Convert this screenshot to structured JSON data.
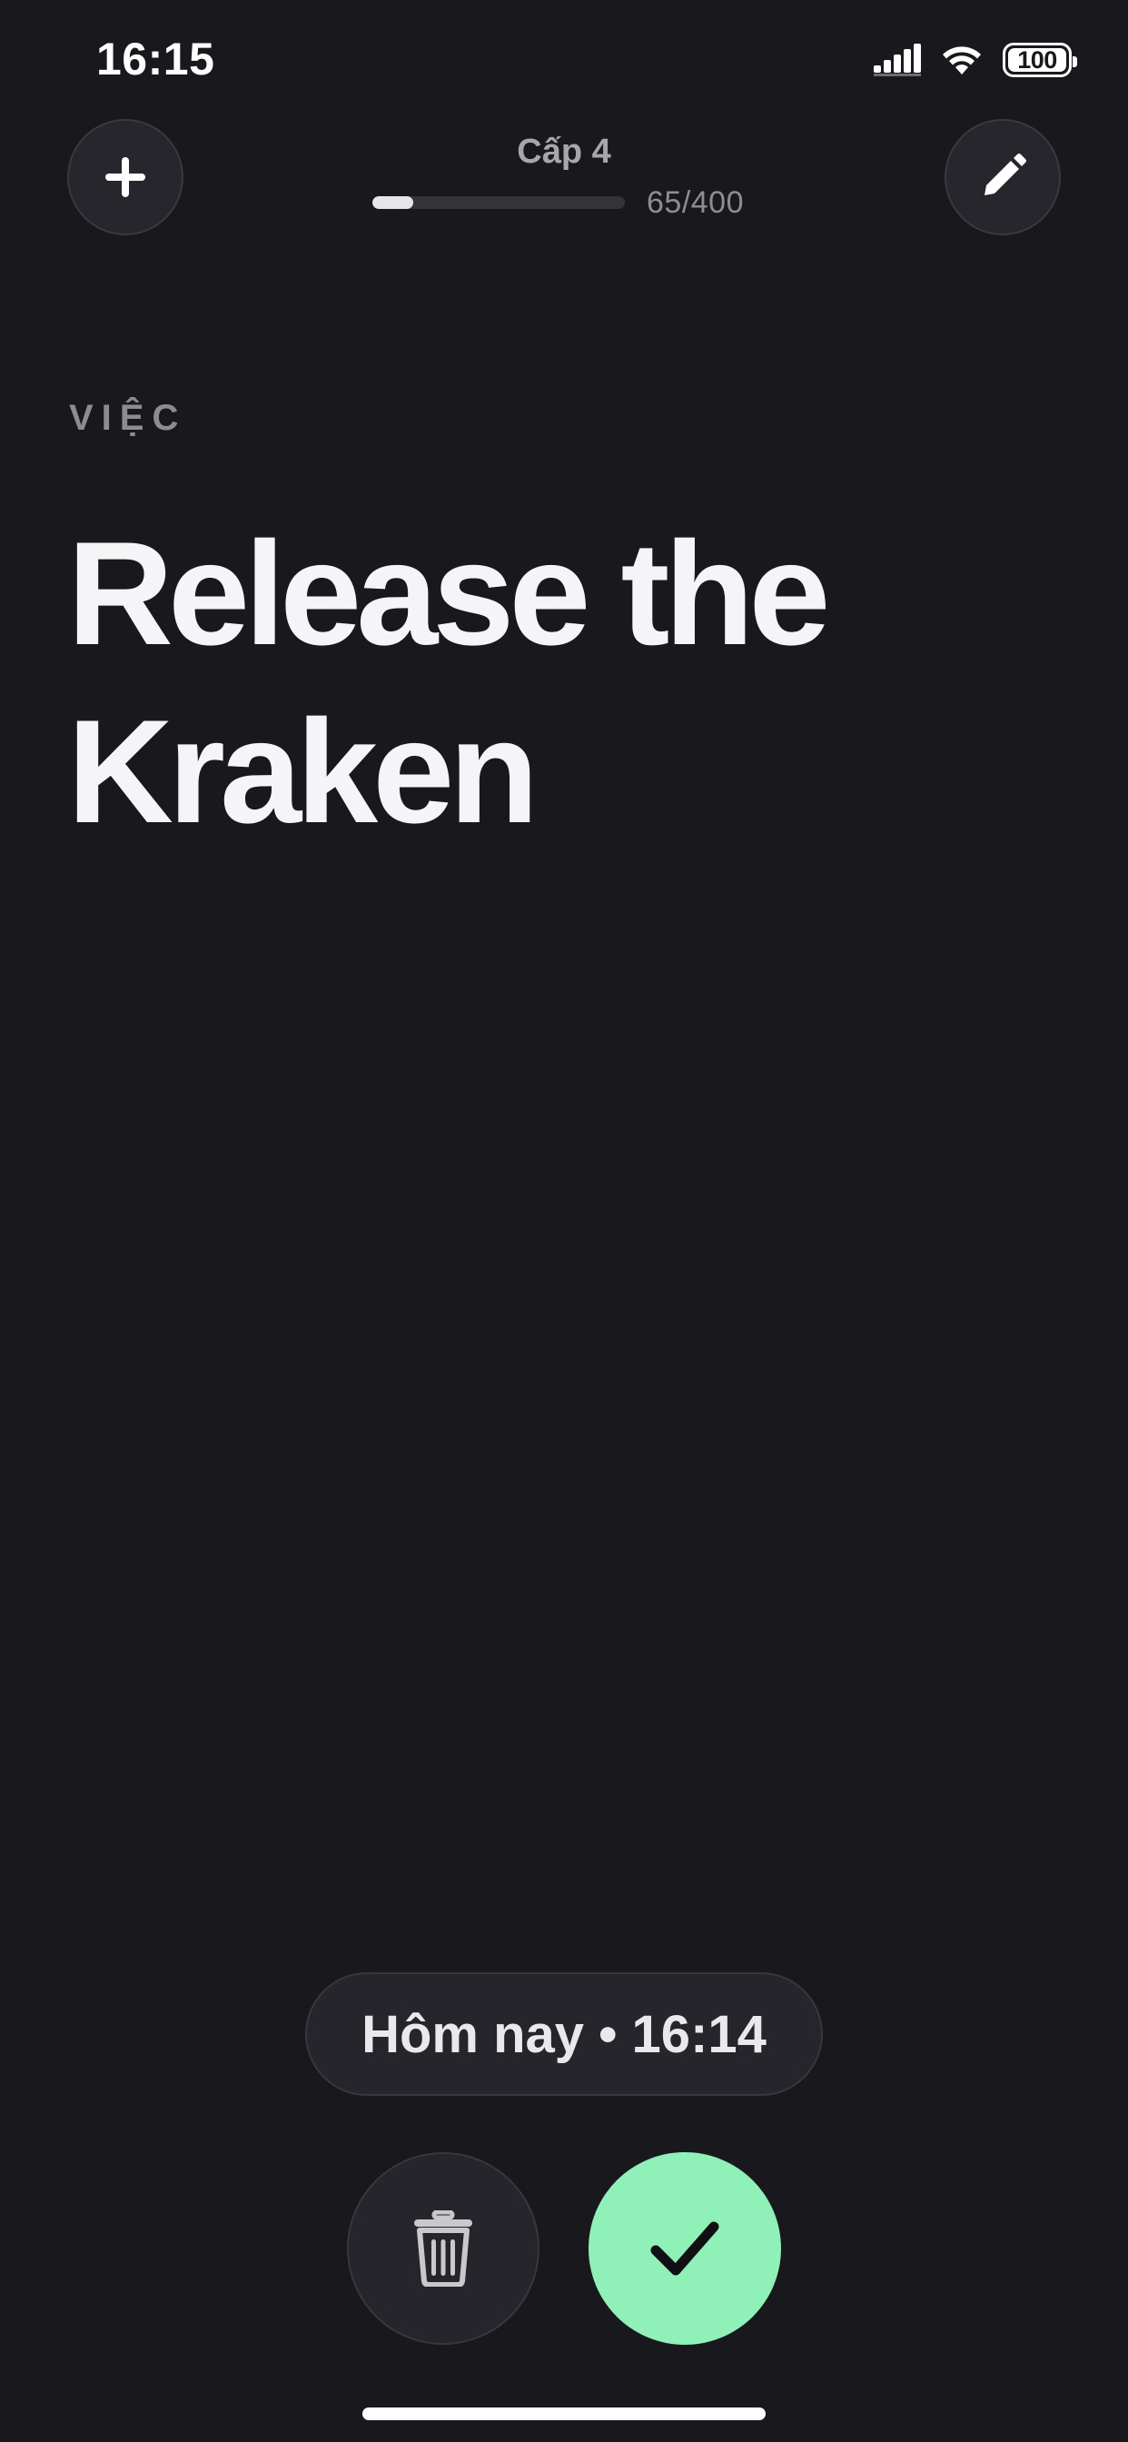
{
  "status_bar": {
    "time": "16:15",
    "battery": "100",
    "icons": [
      "signal-icon",
      "wifi-icon",
      "battery-icon"
    ]
  },
  "header": {
    "add_icon": "plus-icon",
    "edit_icon": "pencil-icon",
    "level_label": "Cấp 4",
    "xp_current": 65,
    "xp_max": 400,
    "xp_text": "65/400"
  },
  "task": {
    "category": "VIỆC",
    "title": "Release the Kraken"
  },
  "footer": {
    "date_label": "Hôm nay • 16:14",
    "delete_icon": "trash-icon",
    "done_icon": "checkmark-icon"
  },
  "colors": {
    "background": "#19181d",
    "surface": "#26252b",
    "accent_done": "#8ff1b7",
    "text_primary": "#f5f5f7",
    "text_muted": "#8d8c92"
  }
}
